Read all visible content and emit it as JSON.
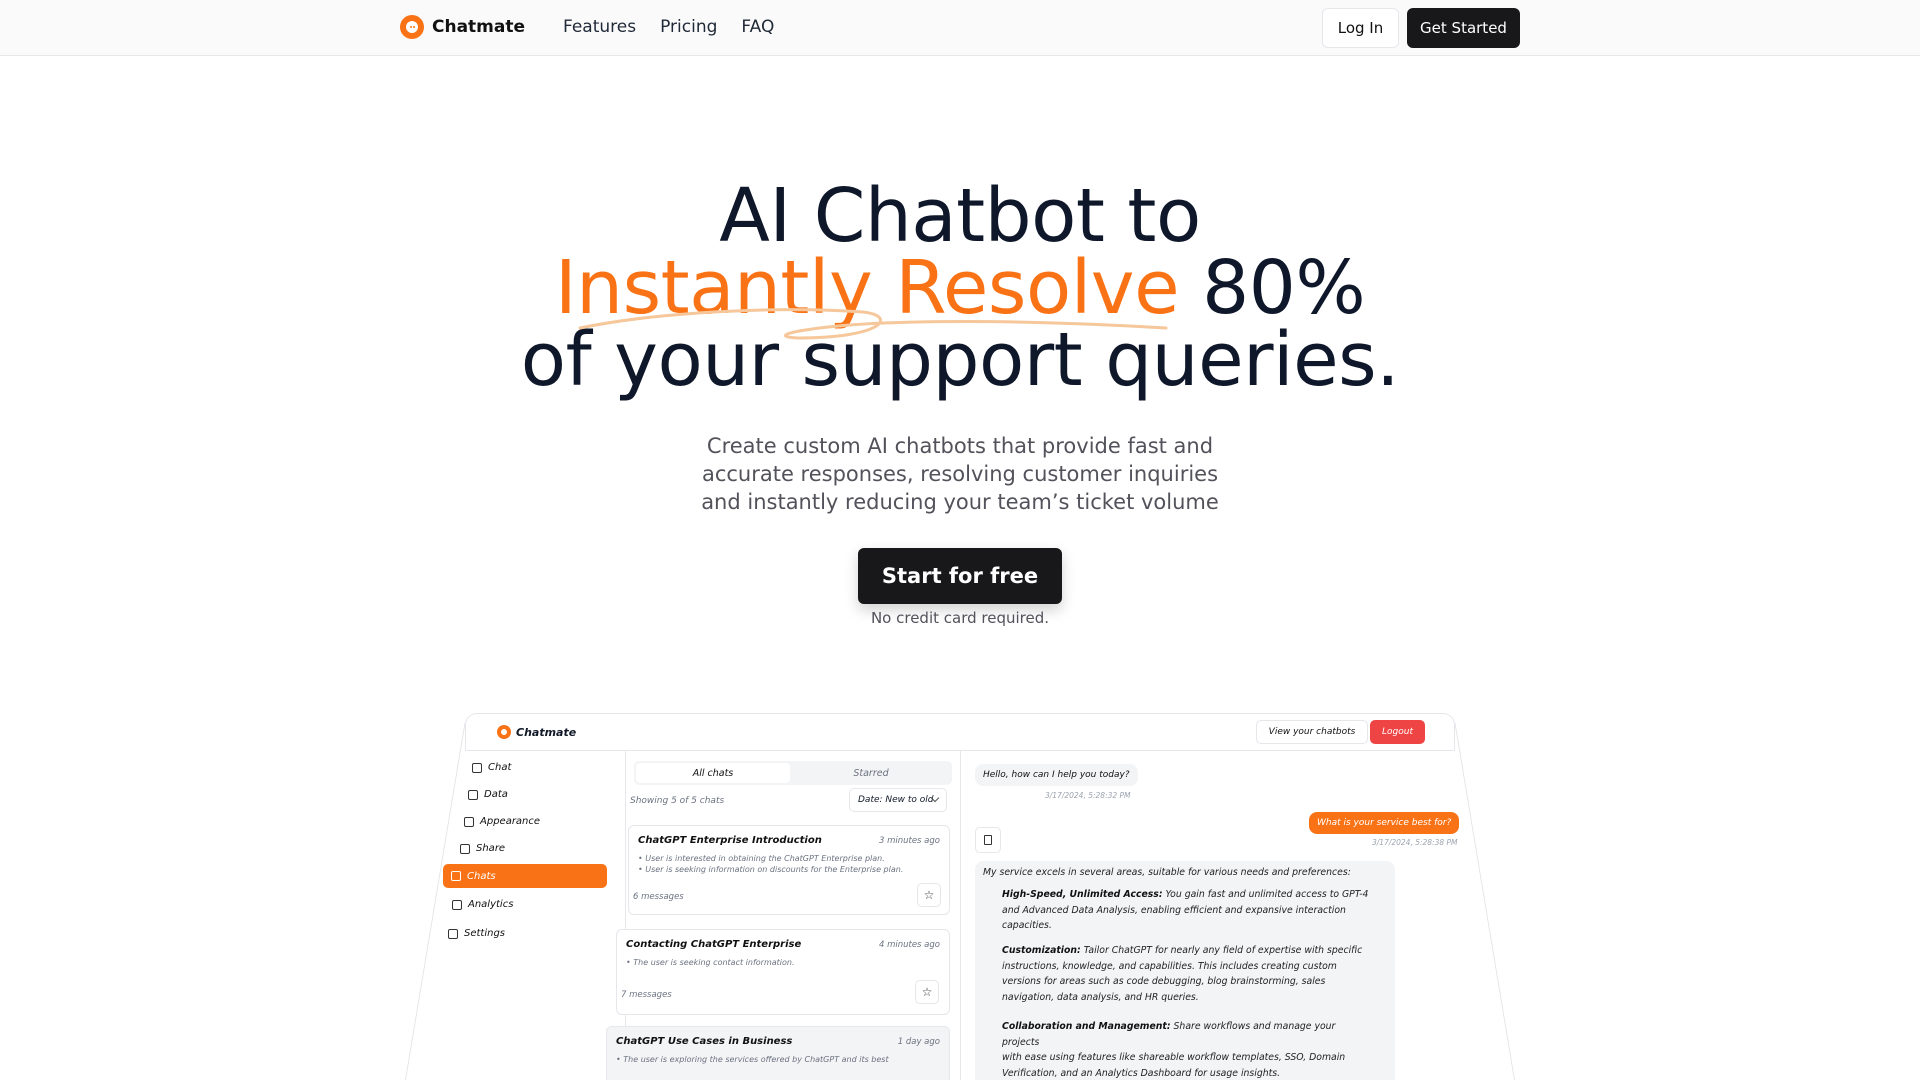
{
  "nav": {
    "brand": "Chatmate",
    "links": [
      "Features",
      "Pricing",
      "FAQ"
    ],
    "login": "Log In",
    "get_started": "Get Started"
  },
  "hero": {
    "title_line1": "AI Chatbot to",
    "title_accent": "Instantly Resolve",
    "title_line2_rest": "80%",
    "title_line3": "of your support queries.",
    "sub_lines": [
      "Create custom AI chatbots that provide fast and",
      "accurate responses, resolving customer inquiries",
      "and instantly reducing your team’s ticket volume"
    ],
    "cta": "Start for free",
    "cta_note": "No credit card required.",
    "accent_color": "#f97316"
  },
  "preview": {
    "brand": "Chatmate",
    "view_chatbots": "View your chatbots",
    "logout": "Logout",
    "sidebar": [
      {
        "label": "Chat",
        "icon": "message-icon"
      },
      {
        "label": "Data",
        "icon": "database-icon"
      },
      {
        "label": "Appearance",
        "icon": "pencil-icon"
      },
      {
        "label": "Share",
        "icon": "share-icon"
      },
      {
        "label": "Chats",
        "icon": "chats-icon",
        "active": true
      },
      {
        "label": "Analytics",
        "icon": "chart-icon"
      },
      {
        "label": "Settings",
        "icon": "gear-icon"
      }
    ],
    "tabs": [
      "All chats",
      "Starred"
    ],
    "showing": "Showing 5 of 5 chats",
    "sort": "Date: New to old",
    "chats": [
      {
        "title": "ChatGPT Enterprise Introduction",
        "time": "3 minutes ago",
        "bullets": [
          "User is interested in obtaining the ChatGPT Enterprise plan.",
          "User is seeking information on discounts for the Enterprise plan."
        ],
        "count": "6 messages"
      },
      {
        "title": "Contacting ChatGPT Enterprise",
        "time": "4 minutes ago",
        "bullets": [
          "The user is seeking contact information."
        ],
        "count": "7 messages"
      },
      {
        "title": "ChatGPT Use Cases in Business",
        "time": "1 day ago",
        "bullets": [
          "The user is exploring the services offered by ChatGPT and its best"
        ],
        "count": ""
      }
    ],
    "messages": {
      "greeting": "Hello, how can I help you today?",
      "greeting_ts": "3/17/2024, 5:28:32 PM",
      "question": "What is your service best for?",
      "question_ts": "3/17/2024, 5:28:38 PM",
      "answer_intro": "My service excels in several areas, suitable for various needs and preferences:",
      "sections": [
        {
          "head": "High-Speed, Unlimited Access:",
          "lines": [
            " You gain fast and unlimited access to GPT-4",
            "and Advanced Data Analysis, enabling efficient and expansive interaction",
            "capacities."
          ]
        },
        {
          "head": "Customization:",
          "lines": [
            " Tailor ChatGPT for nearly any field of expertise with specific",
            "instructions, knowledge, and capabilities. This includes creating custom",
            "versions for areas such as code debugging, blog brainstorming, sales",
            "navigation, data analysis, and HR queries."
          ]
        },
        {
          "head": "Collaboration and Management:",
          "lines": [
            " Share workflows and manage your projects",
            "with ease using features like shareable workflow templates, SSO, Domain",
            "Verification, and an Analytics Dashboard for usage insights."
          ]
        }
      ]
    }
  }
}
